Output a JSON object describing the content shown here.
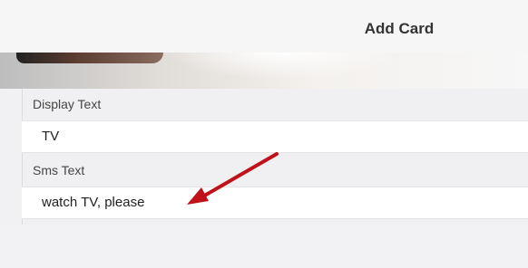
{
  "header": {
    "title": "Add Card"
  },
  "form": {
    "display_text": {
      "label": "Display Text",
      "value": "TV"
    },
    "sms_text": {
      "label": "Sms Text",
      "value": "watch TV, please"
    }
  },
  "annotation": {
    "arrow_color": "#c0121b"
  }
}
